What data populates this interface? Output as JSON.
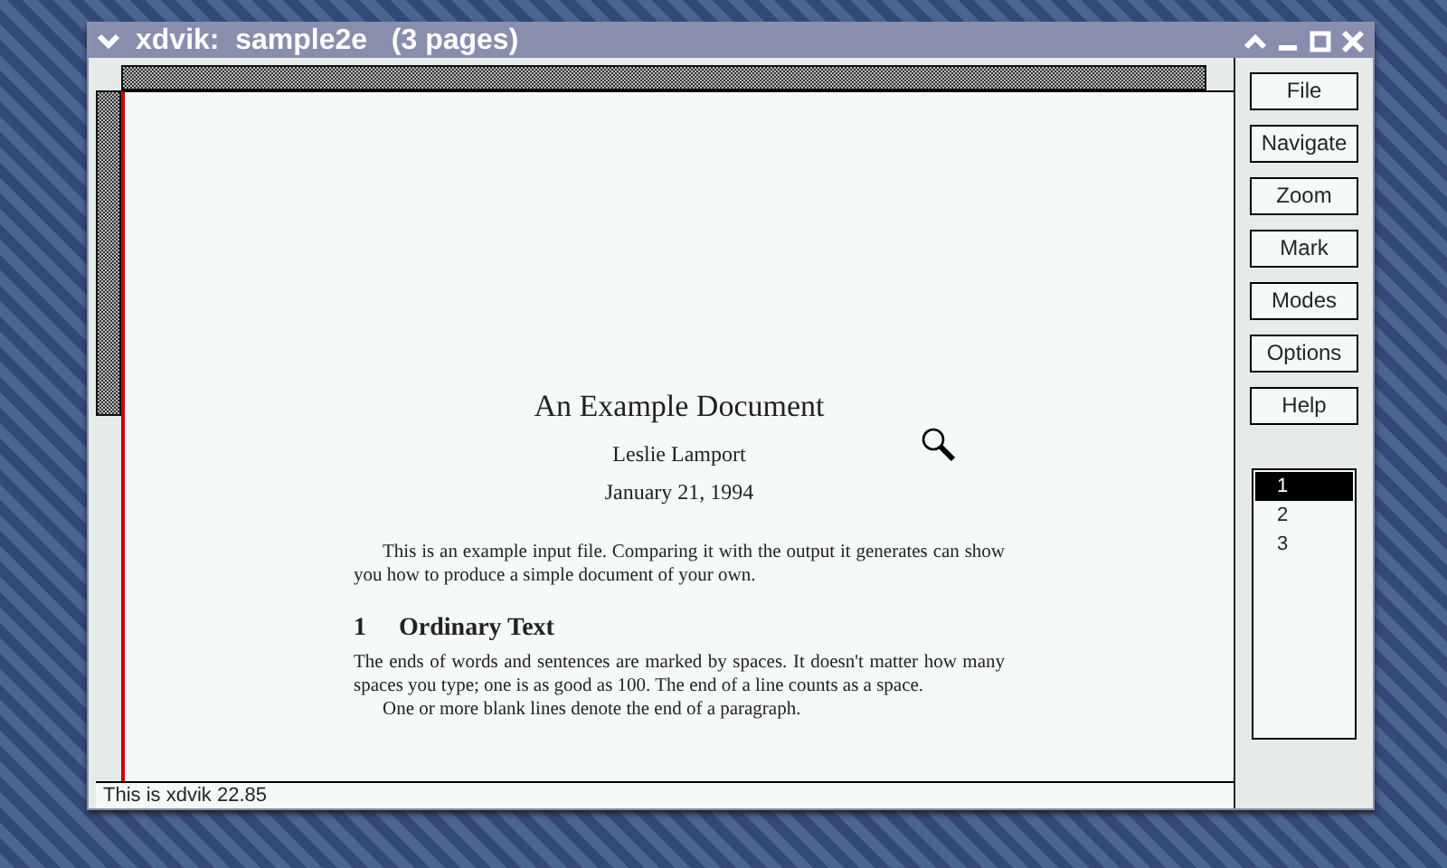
{
  "window": {
    "title": "xdvik:  sample2e   (3 pages)"
  },
  "document": {
    "title": "An Example Document",
    "author": "Leslie Lamport",
    "date": "January 21, 1994",
    "abstract": "This is an example input file. Comparing it with the output it generates can show you how to produce a simple document of your own.",
    "section": {
      "number": "1",
      "title": "Ordinary Text"
    },
    "paragraphs": [
      "The ends of words and sentences are marked by spaces. It doesn't matter how many spaces you type; one is as good as 100.  The end of a line counts as a space.",
      "One or more blank lines denote the end of a paragraph."
    ]
  },
  "status_bar": "This is xdvik 22.85",
  "buttons": [
    "File",
    "Navigate",
    "Zoom",
    "Mark",
    "Modes",
    "Options",
    "Help"
  ],
  "pages": [
    {
      "label": "1",
      "selected": true
    },
    {
      "label": "2",
      "selected": false
    },
    {
      "label": "3",
      "selected": false
    }
  ]
}
